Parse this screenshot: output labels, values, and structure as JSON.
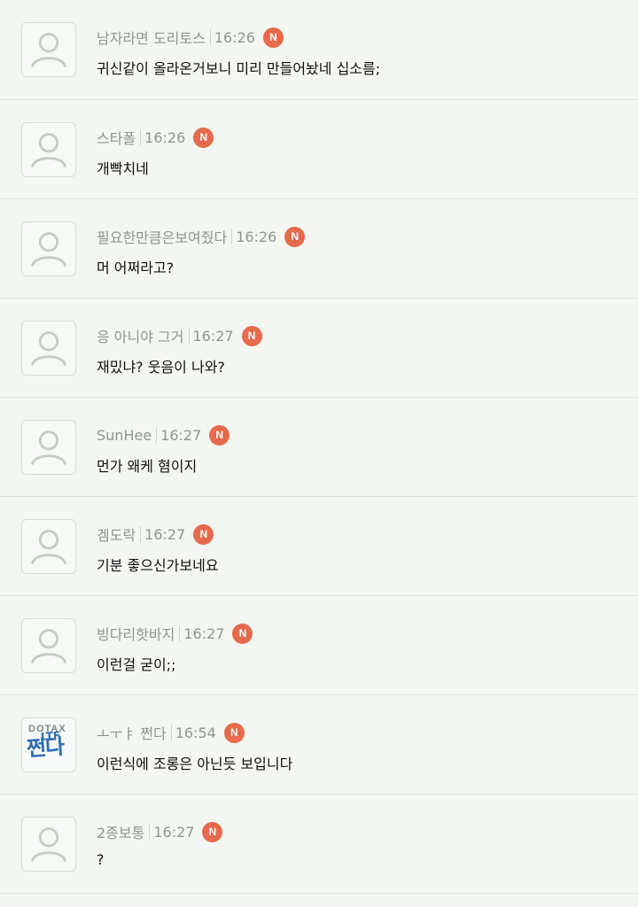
{
  "comments": [
    {
      "nickname": "남자라면 도리토스",
      "time": "16:26",
      "badge": "N",
      "text": "귀신같이 올라온거보니 미리 만들어놨네 십소름;",
      "avatar": "default-avatar-icon"
    },
    {
      "nickname": "스타폴",
      "time": "16:26",
      "badge": "N",
      "text": "개빡치네",
      "avatar": "default-avatar-icon"
    },
    {
      "nickname": "필요한만큼은보여줬다",
      "time": "16:26",
      "badge": "N",
      "text": "머 어쩌라고?",
      "avatar": "default-avatar-icon"
    },
    {
      "nickname": "응 아니야 그거",
      "time": "16:27",
      "badge": "N",
      "text": "재밌냐? 웃음이 나와?",
      "avatar": "default-avatar-icon"
    },
    {
      "nickname": "SunHee",
      "time": "16:27",
      "badge": "N",
      "text": "먼가 왜케 혐이지",
      "avatar": "default-avatar-icon"
    },
    {
      "nickname": "겜도락",
      "time": "16:27",
      "badge": "N",
      "text": "기분 좋으신가보네요",
      "avatar": "default-avatar-icon"
    },
    {
      "nickname": "빙다리핫바지",
      "time": "16:27",
      "badge": "N",
      "text": "이런걸 굳이;;",
      "avatar": "default-avatar-icon"
    },
    {
      "nickname": "ㅗㅜㅑ 쩐다",
      "time": "16:54",
      "badge": "N",
      "text": "이런식에 조롱은 아닌듯 보입니다",
      "avatar": "dotax-logo-avatar",
      "avatar_small": "DOTAX",
      "avatar_top": "LTF",
      "avatar_main": "쩐다"
    },
    {
      "nickname": "2종보통",
      "time": "16:27",
      "badge": "N",
      "text": "?",
      "avatar": "default-avatar-icon"
    }
  ],
  "colors": {
    "background": "#f3f6f1",
    "badge": "#e66a4c",
    "nickname": "#8f9691",
    "divider": "#dde3db"
  }
}
